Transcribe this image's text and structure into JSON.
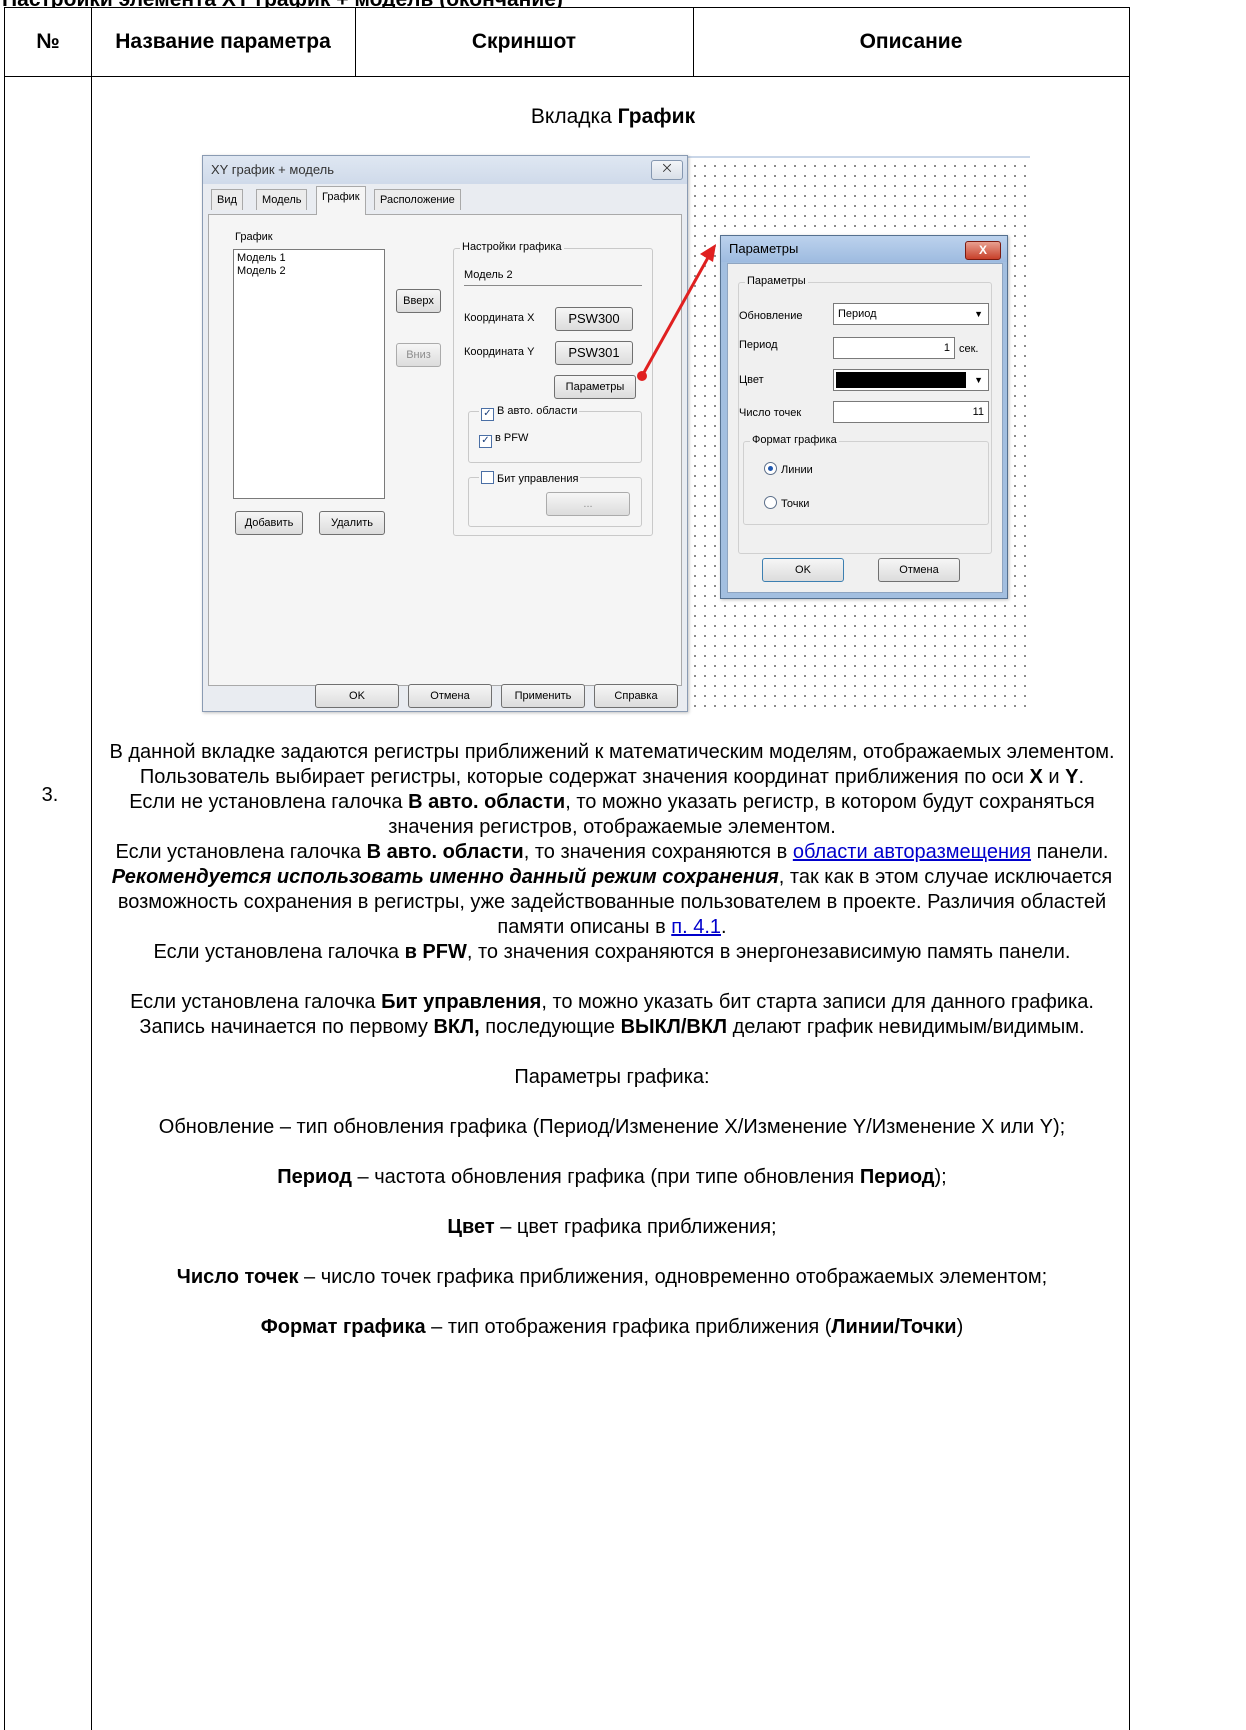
{
  "page_top_fragment": "Настройки элемента XY график + модель (окончание)",
  "table": {
    "headers": [
      "№",
      "Название параметра",
      "Скриншот",
      "Описание"
    ],
    "row_number": "3."
  },
  "tab_heading_prefix": "Вкладка ",
  "tab_heading_bold": "График",
  "dialog_main": {
    "title": "XY график + модель",
    "close": "⨉",
    "tabs": [
      "Вид",
      "Модель",
      "График",
      "Расположение"
    ],
    "graph_list_label": "График",
    "graph_list": [
      "Модель 1",
      "Модель 2"
    ],
    "up_button": "Вверх",
    "down_button": "Вниз",
    "settings_group": "Настройки графика",
    "model_name": "Модель 2",
    "coord_x_label": "Координата X",
    "coord_x_value": "PSW300",
    "coord_y_label": "Координата Y",
    "coord_y_value": "PSW301",
    "params_button": "Параметры",
    "auto_area_label": "В авто. области",
    "pfw_label": "в PFW",
    "control_bit_label": "Бит управления",
    "ellipsis_button": "...",
    "add_button": "Добавить",
    "delete_button": "Удалить",
    "ok_button": "OK",
    "cancel_button": "Отмена",
    "apply_button": "Применить",
    "help_button": "Справка"
  },
  "dialog_params": {
    "title": "Параметры",
    "close": "X",
    "group": "Параметры",
    "update_label": "Обновление",
    "update_value": "Период",
    "period_label": "Период",
    "period_value": "1",
    "period_unit": "сек.",
    "color_label": "Цвет",
    "color_value": "#000000",
    "points_label": "Число точек",
    "points_value": "11",
    "format_group": "Формат графика",
    "radio_lines": "Линии",
    "radio_points": "Точки",
    "ok_button": "OK",
    "cancel_button": "Отмена"
  },
  "description": {
    "p1_a": "В данной вкладке задаются регистры приближений к математическим моделям, отображаемых элементом. Пользователь выбирает регистры, которые содержат значения координат приближения по оси ",
    "p1_x": "X",
    "p1_and": " и ",
    "p1_y": "Y",
    "p1_end": ".",
    "p2_a": "Если не установлена галочка ",
    "p2_b": "В авто. области",
    "p2_c": ", то можно указать регистр, в котором будут сохраняться значения регистров, отображаемые элементом.",
    "p3_a": "Если установлена галочка ",
    "p3_b": "В авто. области",
    "p3_c": ", то значения сохраняются в ",
    "p3_link": "области авторазмещения",
    "p3_d": " панели. ",
    "p3_e": "Рекомендуется использовать именно данный режим сохранения",
    "p3_f": ", так как в этом случае исключается возможность сохранения в регистры, уже задействованные пользователем в проекте. Различия областей памяти описаны в ",
    "p3_link2": "п. 4.1",
    "p3_g": ".",
    "p4_a": "Если установлена галочка ",
    "p4_b": "в PFW",
    "p4_c": ", то значения сохраняются в энергонезависимую память панели.",
    "p5_a": "Если установлена галочка ",
    "p5_b": "Бит управления",
    "p5_c": ", то можно указать бит старта записи для данного графика. Запись начинается по первому ",
    "p5_d": "ВКЛ,",
    "p5_e": " последующие ",
    "p5_f": "ВЫКЛ/ВКЛ",
    "p5_g": " делают график невидимым/видимым.",
    "p6": "Параметры графика:",
    "p7": "Обновление – тип обновления графика (Период/Изменение X/Изменение Y/Изменение X или Y);",
    "p8_a": "Период",
    "p8_b": " – частота обновления графика (при типе обновления ",
    "p8_c": "Период",
    "p8_d": ");",
    "p9_a": "Цвет",
    "p9_b": " – цвет графика приближения;",
    "p10_a": "Число точек",
    "p10_b": " – число точек графика приближения, одновременно отображаемых элементом;",
    "p11_a": "Формат графика",
    "p11_b": " – тип отображения графика приближения (",
    "p11_c": "Линии/Точки",
    "p11_d": ")"
  }
}
